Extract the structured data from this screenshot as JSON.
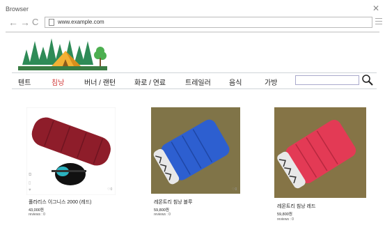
{
  "browser": {
    "label": "Browser",
    "close": "✕",
    "back": "←",
    "forward": "→",
    "reload": "C",
    "url": "www.example.com"
  },
  "nav": {
    "categories": [
      "텐트",
      "침낭",
      "버너 / 랜턴",
      "화로 / 연료",
      "트레일러",
      "음식",
      "가방"
    ],
    "active_index": 1,
    "search_placeholder": ""
  },
  "products": [
    {
      "name": "폴라리스 이그니스 2000 (레드)",
      "price": "43,000원",
      "reviews": "reviews : 0",
      "likes": "0",
      "color": "#8e1d2a"
    },
    {
      "name": "레몬트리 침낭 블루",
      "price": "59,800원",
      "reviews": "reviews : 0",
      "likes": "0",
      "color": "#2d5fd0"
    },
    {
      "name": "레몬트리 침낭 레드",
      "price": "59,800원",
      "reviews": "reviews : 0",
      "likes": "",
      "color": "#e33a55"
    }
  ],
  "colors": {
    "active_category": "#d23b3b",
    "nav_border": "#cfd4d8"
  }
}
